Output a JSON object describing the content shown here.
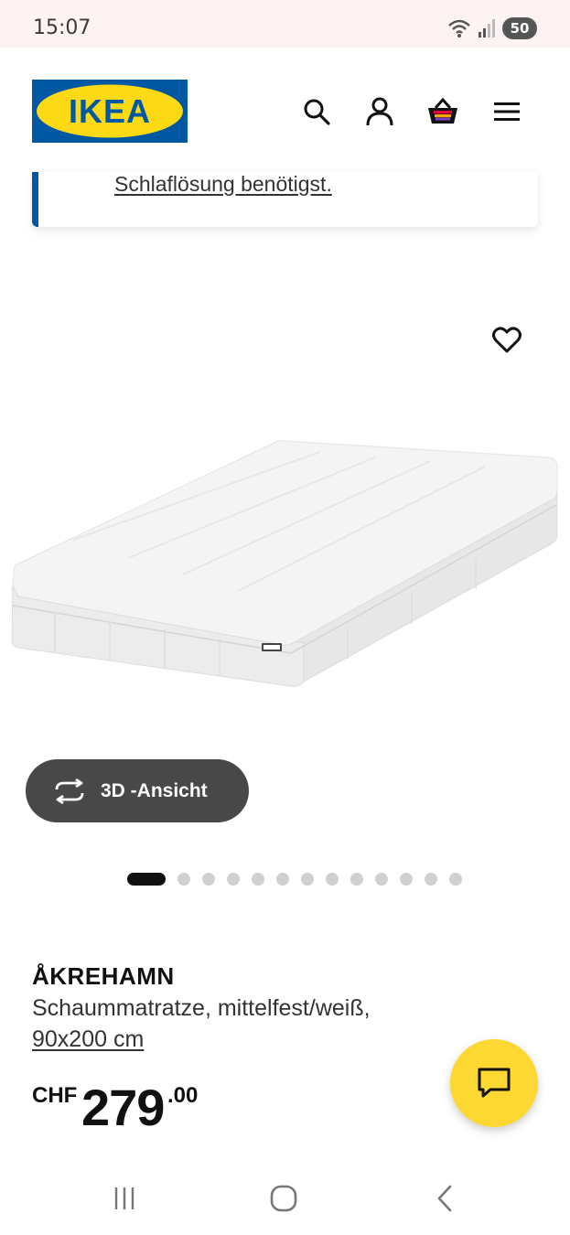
{
  "status_bar": {
    "time": "15:07",
    "battery": "50",
    "icons": [
      "wifi-icon",
      "signal-icon",
      "battery-icon"
    ]
  },
  "header": {
    "logo_text": "IKEA",
    "icons": [
      "search-icon",
      "account-icon",
      "cart-icon",
      "menu-icon"
    ]
  },
  "notice": {
    "link_text": "Schlaflösung benötigst."
  },
  "product": {
    "view_3d_label": "3D -Ansicht",
    "gallery": {
      "total_images": 13,
      "active_index": 1
    },
    "name": "ÅKREHAMN",
    "description": "Schaummatratze, mittelfest/weiß,",
    "size": "90x200 cm",
    "price": {
      "currency": "CHF",
      "integer": "279",
      "decimal": ".00"
    }
  },
  "colors": {
    "ikea_blue": "#0058a3",
    "ikea_yellow": "#fbd914",
    "chat_yellow": "#fdd833",
    "button_dark": "#484848"
  }
}
